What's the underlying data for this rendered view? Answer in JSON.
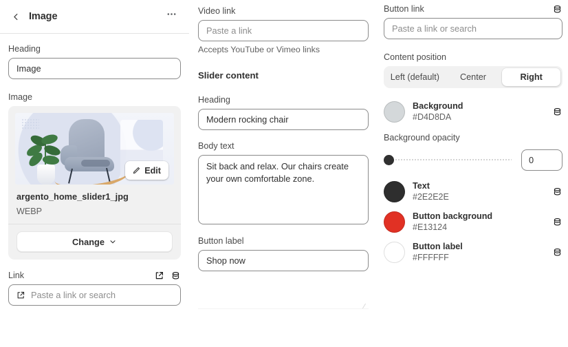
{
  "panel": {
    "title": "Image",
    "back_icon": "chevron-left-icon",
    "more_icon": "more-horizontal-icon"
  },
  "left": {
    "heading_label": "Heading",
    "heading_value": "Image",
    "image_label": "Image",
    "edit_button": "Edit",
    "file_name": "argento_home_slider1_jpg",
    "file_type": "WEBP",
    "change_button": "Change",
    "link_label": "Link",
    "link_placeholder": "Paste a link or search"
  },
  "middle": {
    "video_link_label": "Video link",
    "video_link_placeholder": "Paste a link",
    "video_help": "Accepts YouTube or Vimeo links",
    "slider_content_title": "Slider content",
    "heading_label": "Heading",
    "heading_value": "Modern rocking chair",
    "body_text_label": "Body text",
    "body_text_value": "Sit back and relax. Our chairs create your own comfortable zone.",
    "button_label_label": "Button label",
    "button_label_value": "Shop now"
  },
  "right": {
    "button_link_label": "Button link",
    "button_link_placeholder": "Paste a link or search",
    "content_position_label": "Content position",
    "position_options": [
      {
        "label": "Left (default)",
        "selected": false
      },
      {
        "label": "Center",
        "selected": false
      },
      {
        "label": "Right",
        "selected": true
      }
    ],
    "background": {
      "name": "Background",
      "hex": "#D4D8DA"
    },
    "opacity_label": "Background opacity",
    "opacity_value": "0",
    "colors": [
      {
        "name": "Text",
        "hex": "#2E2E2E"
      },
      {
        "name": "Button background",
        "hex": "#E13124"
      },
      {
        "name": "Button label",
        "hex": "#FFFFFF"
      }
    ]
  }
}
